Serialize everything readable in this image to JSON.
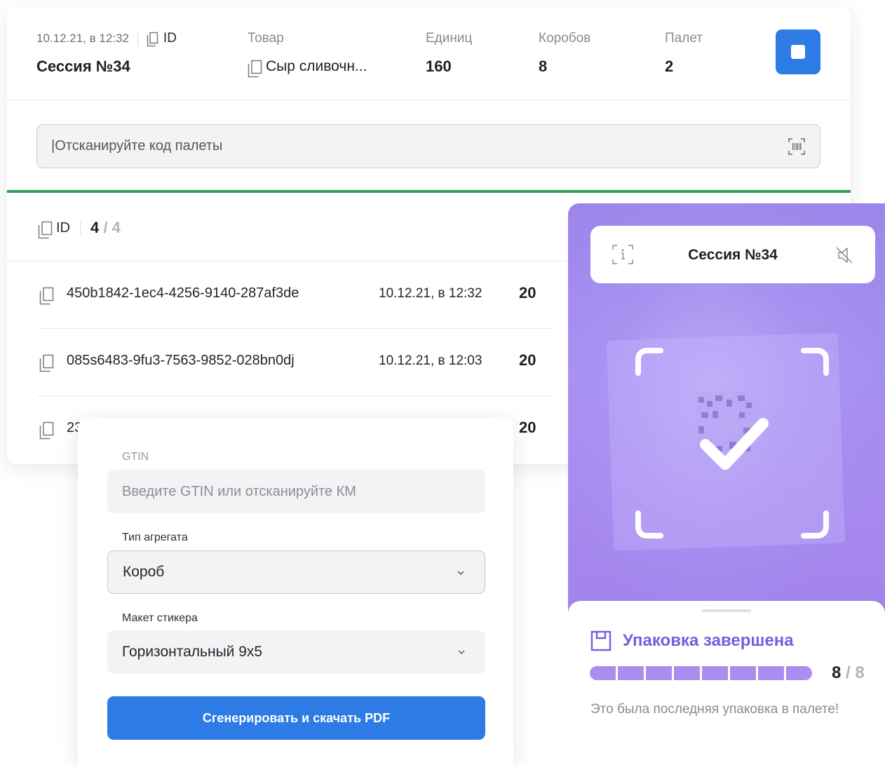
{
  "session": {
    "datetime": "10.12.21, в 12:32",
    "id_label": "ID",
    "title": "Сессия №34",
    "columns": [
      {
        "label": "Товар",
        "value": "Сыр сливочн..."
      },
      {
        "label": "Единиц",
        "value": "160"
      },
      {
        "label": "Коробов",
        "value": "8"
      },
      {
        "label": "Палет",
        "value": "2"
      }
    ],
    "stop_icon": "stop-icon"
  },
  "scan": {
    "placeholder": "|Отсканируйте код палеты",
    "icon": "barcode-scan-icon"
  },
  "list": {
    "id_label": "ID",
    "count_done": "4",
    "count_sep": "/",
    "count_total": "4",
    "rows": [
      {
        "id": "450b1842-1ec4-4256-9140-287af3de",
        "date": "10.12.21, в 12:32",
        "qty": "20"
      },
      {
        "id": "085s6483-9fu3-7563-9852-028bn0dj",
        "date": "10.12.21, в 12:03",
        "qty": "20"
      },
      {
        "id": "23",
        "date": "",
        "qty": "20"
      }
    ]
  },
  "form": {
    "gtin_label": "GTIN",
    "gtin_placeholder": "Введите GTIN или отсканируйте КМ",
    "agg_label": "Тип агрегата",
    "agg_value": "Короб",
    "layout_label": "Макет стикера",
    "layout_value": "Горизонтальный 9x5",
    "generate_button": "Сгенерировать и скачать PDF"
  },
  "mobile": {
    "title": "Сессия №34",
    "status_title": "Упаковка завершена",
    "progress": {
      "done": "8",
      "sep": "/",
      "total": "8",
      "fraction": 1.0
    },
    "note": "Это была последняя упаковка в палете!",
    "colors": {
      "accent_purple": "#7b5be0",
      "progress_fill": "#a98ef0",
      "primary_blue": "#2d7be5",
      "success_green": "#2e9e50"
    }
  }
}
